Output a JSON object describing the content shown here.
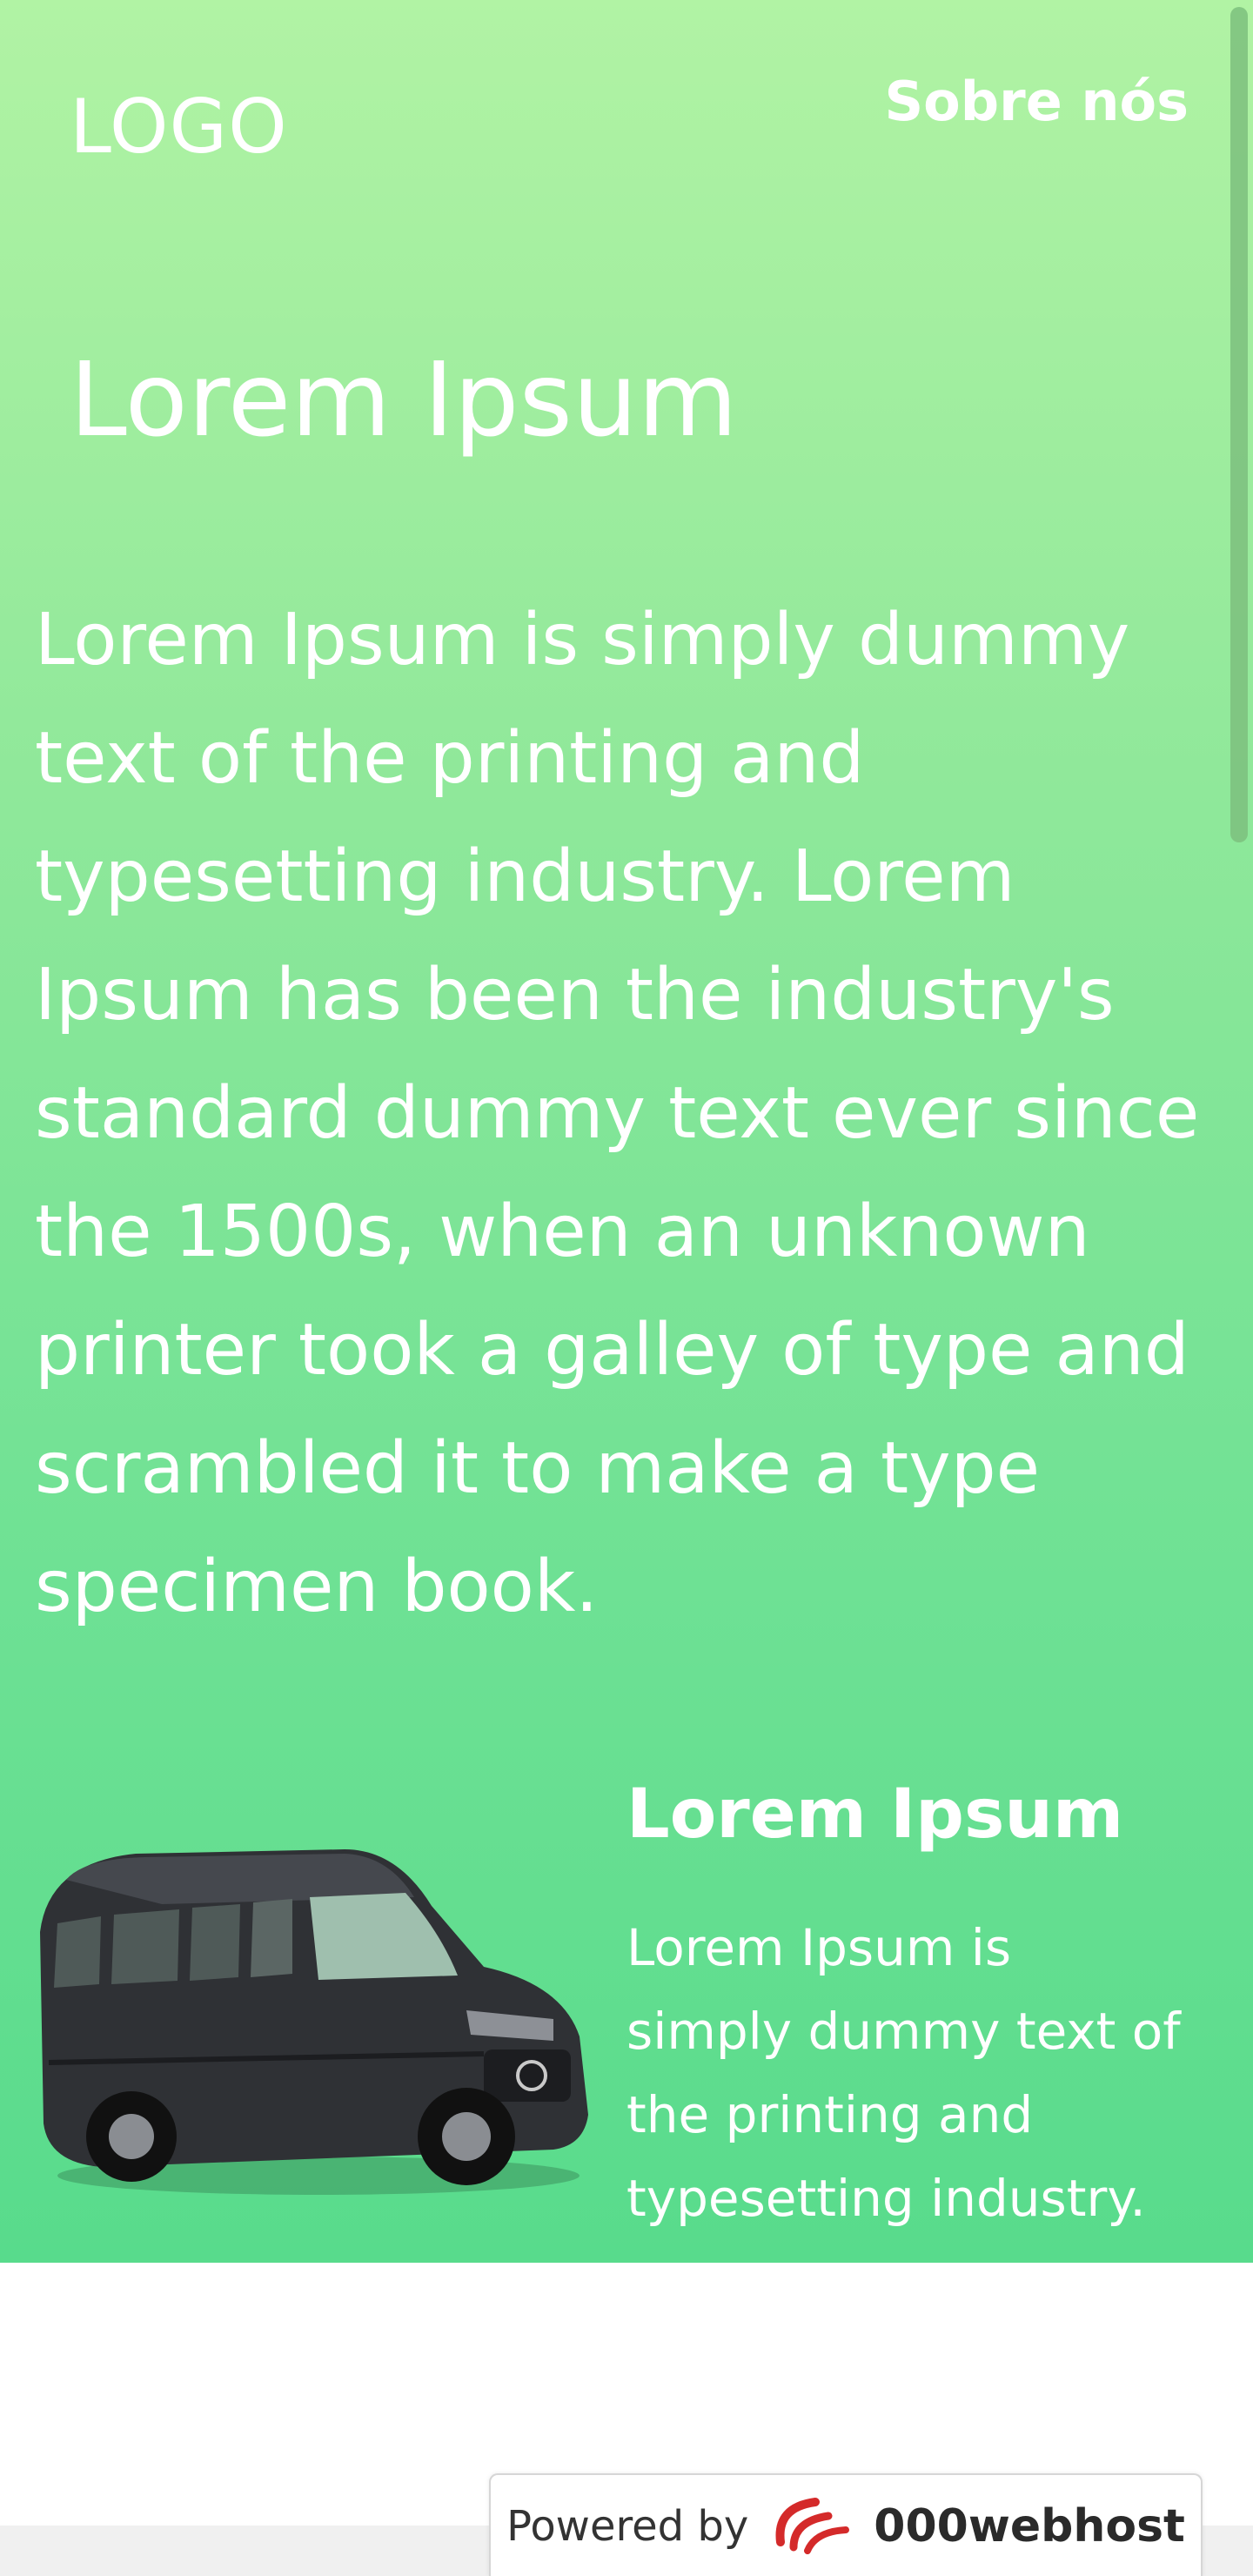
{
  "header": {
    "logo": "LOGO",
    "nav_link": "Sobre nós"
  },
  "hero": {
    "title": "Lorem Ipsum",
    "paragraph": "Lorem Ipsum is simply dummy text of the printing and typesetting industry. Lorem Ipsum has been the industry's standard dummy text ever since the 1500s, when an unknown printer took a galley of type and scrambled it to make a type specimen book."
  },
  "feature": {
    "image_icon": "van-icon",
    "title": "Lorem Ipsum",
    "text": "Lorem Ipsum is simply dummy text of the printing and typesetting industry."
  },
  "footer": {
    "powered_label": "Powered by",
    "brand": "000webhost",
    "brand_icon": "webhost-swirl-icon"
  },
  "colors": {
    "gradient_top": "#b1f3a4",
    "gradient_bottom": "#58db8c",
    "text": "#ffffff",
    "brand_red": "#d42a2a"
  }
}
